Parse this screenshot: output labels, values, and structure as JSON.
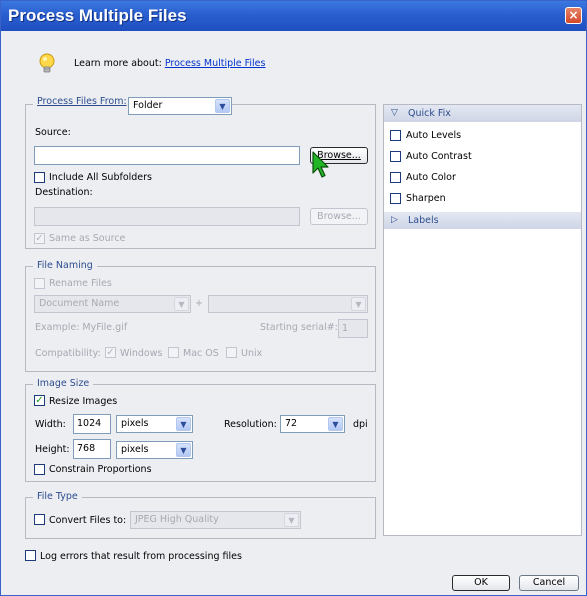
{
  "window": {
    "title": "Process Multiple Files",
    "close_label": "×"
  },
  "learn": {
    "prefix": "Learn more about:",
    "link": "Process Multiple Files"
  },
  "source_group": {
    "process_from_label": "Process Files From:",
    "process_from_value": "Folder",
    "source_label": "Source:",
    "source_value": "",
    "browse_label": "Browse...",
    "include_subfolders_label": "Include All Subfolders",
    "destination_label": "Destination:",
    "destination_value": "",
    "dest_browse_label": "Browse...",
    "same_as_source_label": "Same as Source"
  },
  "file_naming": {
    "legend": "File Naming",
    "rename_label": "Rename Files",
    "name_select": "Document Name",
    "plus": "+",
    "second_select": "",
    "example": "Example: MyFile.gif",
    "starting_serial_label": "Starting serial#:",
    "starting_serial_value": "1",
    "compat_label": "Compatibility:",
    "windows_label": "Windows",
    "macos_label": "Mac OS",
    "unix_label": "Unix"
  },
  "image_size": {
    "legend": "Image Size",
    "resize_label": "Resize Images",
    "width_label": "Width:",
    "width_value": "1024",
    "width_unit": "pixels",
    "height_label": "Height:",
    "height_value": "768",
    "height_unit": "pixels",
    "resolution_label": "Resolution:",
    "resolution_value": "72",
    "dpi_label": "dpi",
    "constrain_label": "Constrain Proportions"
  },
  "file_type": {
    "legend": "File Type",
    "convert_label": "Convert Files to:",
    "convert_value": "JPEG High Quality"
  },
  "log_errors_label": "Log errors that result from processing files",
  "quick_fix": {
    "header": "Quick Fix",
    "items": [
      "Auto Levels",
      "Auto Contrast",
      "Auto Color",
      "Sharpen"
    ],
    "labels_header": "Labels"
  },
  "buttons": {
    "ok": "OK",
    "cancel": "Cancel"
  },
  "colors": {
    "titlebar": "#2a5fd0",
    "dialog_bg": "#edeef2",
    "legend_text": "#2c4d8e",
    "link": "#0033cc"
  },
  "icons": [
    "close-icon",
    "lightbulb-icon",
    "chevron-down-icon",
    "checkmark-icon",
    "triangle-down-icon",
    "triangle-right-icon",
    "pointer-cursor-icon"
  ]
}
